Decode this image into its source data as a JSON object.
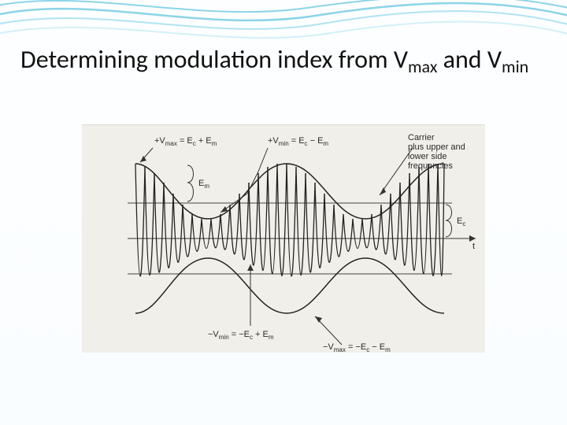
{
  "title_part1": "Determining modulation index from V",
  "title_sub1": "max",
  "title_part2": " and V",
  "title_sub2": "min",
  "figure": {
    "label_pos_vmax": "+V",
    "label_pos_vmax_sub": "max",
    "label_pos_vmax_eq": " = E",
    "label_pos_vmax_eq_sub1": "c",
    "label_pos_vmax_eq2": " + E",
    "label_pos_vmax_eq_sub2": "m",
    "label_pos_vmin": "+V",
    "label_pos_vmin_sub": "min",
    "label_pos_vmin_eq": " = E",
    "label_pos_vmin_eq_sub1": "c",
    "label_pos_vmin_eq2": " − E",
    "label_pos_vmin_eq_sub2": "m",
    "label_neg_vmin": "−V",
    "label_neg_vmin_sub": "min",
    "label_neg_vmin_eq": " = −E",
    "label_neg_vmin_eq_sub1": "c",
    "label_neg_vmin_eq2": " + E",
    "label_neg_vmin_eq_sub2": "m",
    "label_neg_vmax": "−V",
    "label_neg_vmax_sub": "max",
    "label_neg_vmax_eq": " = −E",
    "label_neg_vmax_eq_sub1": "c",
    "label_neg_vmax_eq2": " − E",
    "label_neg_vmax_eq_sub2": "m",
    "label_Em": "E",
    "label_Em_sub": "m",
    "label_Ec": "E",
    "label_Ec_sub": "c",
    "label_t": "t",
    "label_carrier_line1": "Carrier",
    "label_carrier_line2": "plus upper and",
    "label_carrier_line3": "lower side",
    "label_carrier_line4": "frequencies"
  }
}
